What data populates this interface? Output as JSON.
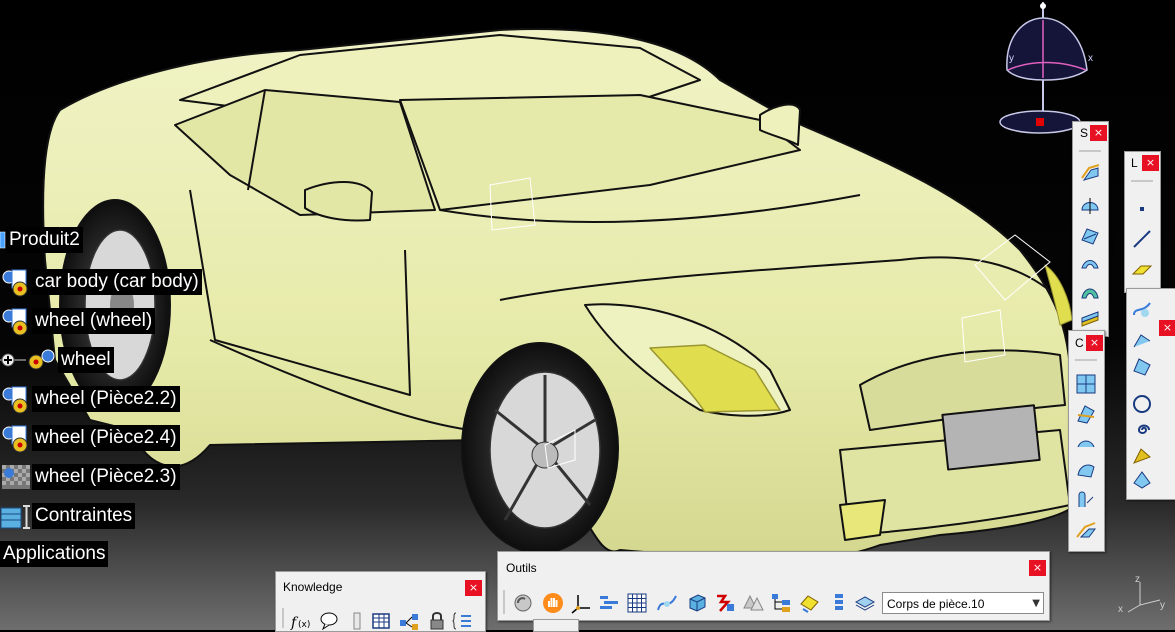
{
  "tree": {
    "root": "Produit2",
    "nodes": [
      {
        "label": "car body (car body)"
      },
      {
        "label": "wheel (wheel)"
      },
      {
        "label": "wheel"
      },
      {
        "label": "wheel (Pièce2.2)"
      },
      {
        "label": "wheel (Pièce2.4)"
      },
      {
        "label": "wheel (Pièce2.3)"
      },
      {
        "label": "Contraintes"
      }
    ],
    "applications": "Applications"
  },
  "compass": {
    "x_label": "x",
    "y_label": "y"
  },
  "toolbars": {
    "knowledge": {
      "title": "Knowledge"
    },
    "outils": {
      "title": "Outils",
      "body_select": "Corps de pièce.10"
    },
    "s": {
      "title": "S"
    },
    "l": {
      "title": "L"
    },
    "c": {
      "title": "C"
    }
  },
  "axis_indicator": {
    "x": "x",
    "y": "y",
    "z": "z"
  },
  "colors": {
    "car_body": "#ecefb4",
    "close_button": "#e81123",
    "toolbar_bg": "#f0f0f0",
    "compass_fill": "#15153a"
  }
}
